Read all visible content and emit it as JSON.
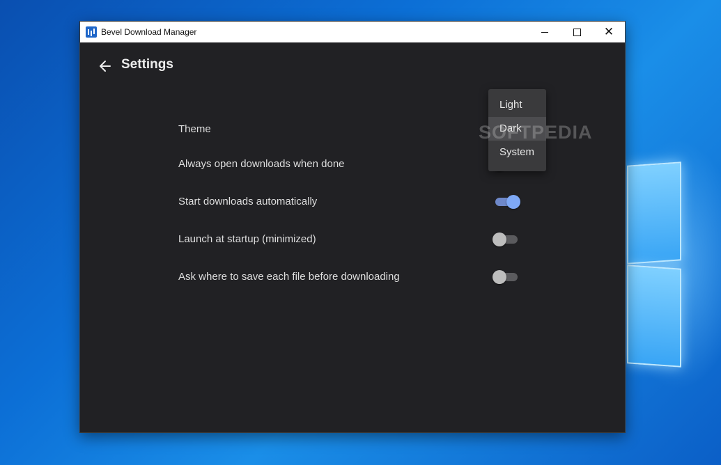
{
  "window": {
    "title": "Bevel Download Manager"
  },
  "header": {
    "title": "Settings"
  },
  "settings": [
    {
      "label": "Theme",
      "control": "dropdown"
    },
    {
      "label": "Always open downloads when done",
      "control": "toggle",
      "state": "off"
    },
    {
      "label": "Start downloads automatically",
      "control": "toggle",
      "state": "on"
    },
    {
      "label": "Launch at startup (minimized)",
      "control": "toggle",
      "state": "off"
    },
    {
      "label": "Ask where to save each file before downloading",
      "control": "toggle",
      "state": "off"
    }
  ],
  "theme_menu": {
    "options": [
      "Light",
      "Dark",
      "System"
    ],
    "highlighted": "Dark"
  },
  "watermark": "SOFTPEDIA",
  "colors": {
    "app_background": "#212124",
    "toggle_on": "#7ea8f5",
    "toggle_off": "#bdbdbd",
    "menu_background": "#3a3a3c"
  },
  "icons": {
    "back": "arrow-left-icon",
    "minimize": "minimize-icon",
    "maximize": "maximize-icon",
    "close": "close-icon"
  }
}
